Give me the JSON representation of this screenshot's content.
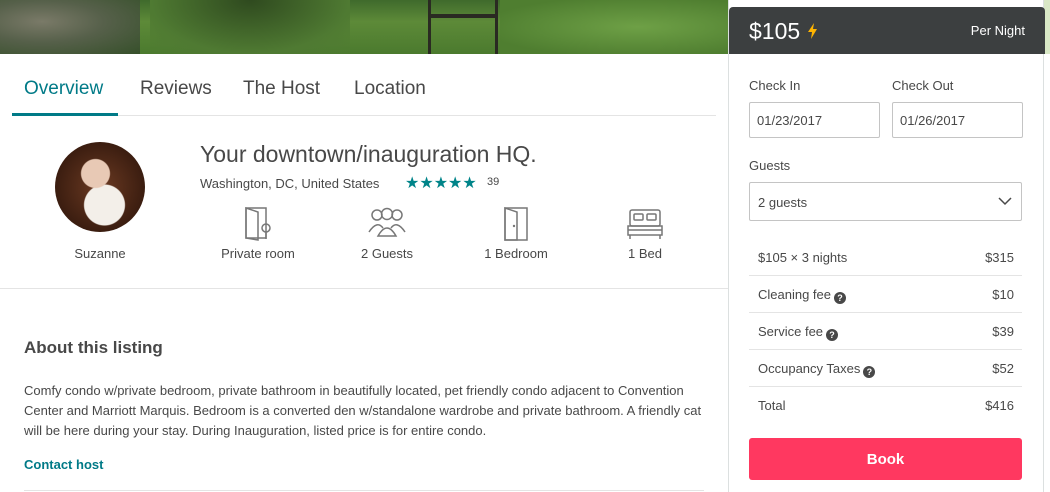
{
  "tabs": [
    {
      "label": "Overview",
      "active": true
    },
    {
      "label": "Reviews",
      "active": false
    },
    {
      "label": "The Host",
      "active": false
    },
    {
      "label": "Location",
      "active": false
    }
  ],
  "host": {
    "name": "Suzanne"
  },
  "listing": {
    "title": "Your downtown/inauguration HQ.",
    "location": "Washington, DC, United States",
    "rating_stars": 5,
    "stars_text": "★★★★★",
    "review_count": "39"
  },
  "amenities": [
    {
      "label": "Private room",
      "icon": "door-key-icon"
    },
    {
      "label": "2 Guests",
      "icon": "guests-icon"
    },
    {
      "label": "1 Bedroom",
      "icon": "bedroom-door-icon"
    },
    {
      "label": "1 Bed",
      "icon": "bed-icon"
    }
  ],
  "about": {
    "heading": "About this listing",
    "text": "Comfy condo w/private bedroom, private bathroom in beautifully located, pet friendly condo adjacent to Convention Center and Marriott Marquis. Bedroom is a converted den w/standalone wardrobe and private bathroom. A friendly cat will be here during your stay. During Inauguration, listed price is for entire condo.",
    "contact_label": "Contact host"
  },
  "booking": {
    "price": "$105",
    "instant_book_icon": "lightning-bolt-icon",
    "per_night": "Per Night",
    "check_in_label": "Check In",
    "check_in_value": "01/23/2017",
    "check_out_label": "Check Out",
    "check_out_value": "01/26/2017",
    "guests_label": "Guests",
    "guests_value": "2 guests",
    "rows": [
      {
        "label": "$105 × 3 nights",
        "value": "$315",
        "help": false
      },
      {
        "label": "Cleaning fee",
        "value": "$10",
        "help": true
      },
      {
        "label": "Service fee",
        "value": "$39",
        "help": true
      },
      {
        "label": "Occupancy Taxes",
        "value": "$52",
        "help": true
      },
      {
        "label": "Total",
        "value": "$416",
        "help": false
      }
    ],
    "help_glyph": "?",
    "book_label": "Book"
  },
  "colors": {
    "accent_teal": "#007a87",
    "book_button": "#ff3860",
    "price_bar": "#3c3f40",
    "bolt": "#ffb400"
  }
}
